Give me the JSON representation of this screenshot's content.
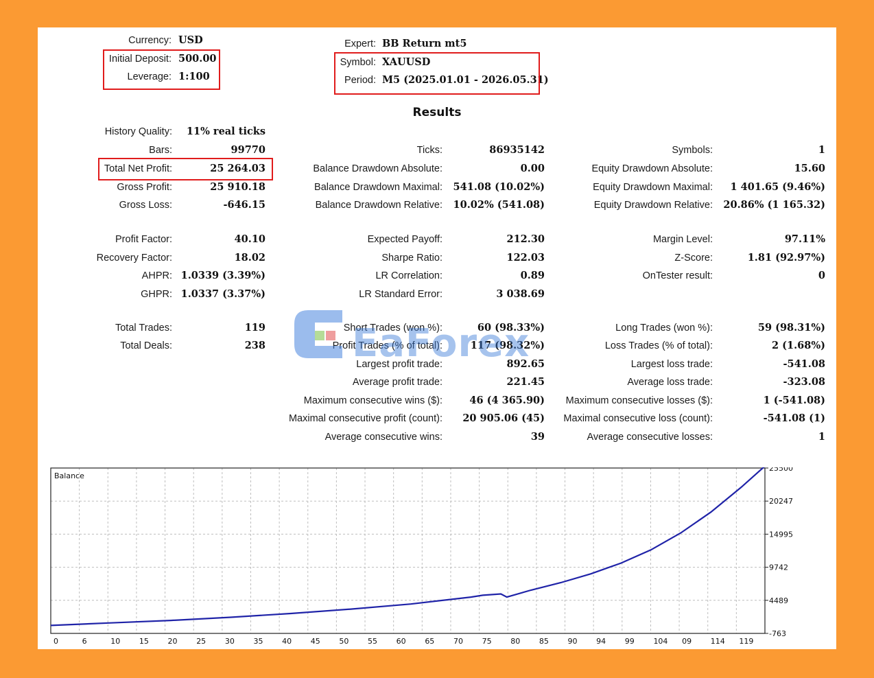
{
  "header": {
    "currency": {
      "label": "Currency:",
      "value": "USD"
    },
    "initial_deposit": {
      "label": "Initial Deposit:",
      "value": "500.00"
    },
    "leverage": {
      "label": "Leverage:",
      "value": "1:100"
    },
    "expert": {
      "label": "Expert:",
      "value": "BB Return mt5"
    },
    "symbol": {
      "label": "Symbol:",
      "value": "XAUUSD"
    },
    "period": {
      "label": "Period:",
      "value": "M5 (2025.01.01 - 2026.05.31)"
    }
  },
  "results_title": "Results",
  "left_col": [
    {
      "label": "History Quality:",
      "value": "11% real ticks"
    },
    {
      "label": "Bars:",
      "value": "99770"
    },
    {
      "label": "Total Net Profit:",
      "value": "25 264.03"
    },
    {
      "label": "Gross Profit:",
      "value": "25 910.18"
    },
    {
      "label": "Gross Loss:",
      "value": "-646.15"
    },
    {
      "label": "Profit Factor:",
      "value": "40.10"
    },
    {
      "label": "Recovery Factor:",
      "value": "18.02"
    },
    {
      "label": "AHPR:",
      "value": "1.0339 (3.39%)"
    },
    {
      "label": "GHPR:",
      "value": "1.0337 (3.37%)"
    },
    {
      "label": "Total Trades:",
      "value": "119"
    },
    {
      "label": "Total Deals:",
      "value": "238"
    }
  ],
  "mid_col": [
    {
      "label": "Ticks:",
      "value": "86935142"
    },
    {
      "label": "Balance Drawdown Absolute:",
      "value": "0.00"
    },
    {
      "label": "Balance Drawdown Maximal:",
      "value": "541.08 (10.02%)"
    },
    {
      "label": "Balance Drawdown Relative:",
      "value": "10.02% (541.08)"
    },
    {
      "label": "Expected Payoff:",
      "value": "212.30"
    },
    {
      "label": "Sharpe Ratio:",
      "value": "122.03"
    },
    {
      "label": "LR Correlation:",
      "value": "0.89"
    },
    {
      "label": "LR Standard Error:",
      "value": "3 038.69"
    },
    {
      "label": "Short Trades (won %):",
      "value": "60 (98.33%)"
    },
    {
      "label": "Profit Trades (% of total):",
      "value": "117 (98.32%)"
    },
    {
      "label": "Largest profit trade:",
      "value": "892.65"
    },
    {
      "label": "Average profit trade:",
      "value": "221.45"
    },
    {
      "label": "Maximum consecutive wins ($):",
      "value": "46 (4 365.90)"
    },
    {
      "label": "Maximal consecutive profit (count):",
      "value": "20 905.06 (45)"
    },
    {
      "label": "Average consecutive wins:",
      "value": "39"
    }
  ],
  "right_col": [
    {
      "label": "Symbols:",
      "value": "1"
    },
    {
      "label": "Equity Drawdown Absolute:",
      "value": "15.60"
    },
    {
      "label": "Equity Drawdown Maximal:",
      "value": "1 401.65 (9.46%)"
    },
    {
      "label": "Equity Drawdown Relative:",
      "value": "20.86% (1 165.32)"
    },
    {
      "label": "Margin Level:",
      "value": "97.11%"
    },
    {
      "label": "Z-Score:",
      "value": "1.81 (92.97%)"
    },
    {
      "label": "OnTester result:",
      "value": "0"
    },
    {
      "label": "Long Trades (won %):",
      "value": "59 (98.31%)"
    },
    {
      "label": "Loss Trades (% of total):",
      "value": "2 (1.68%)"
    },
    {
      "label": "Largest loss trade:",
      "value": "-541.08"
    },
    {
      "label": "Average loss trade:",
      "value": "-323.08"
    },
    {
      "label": "Maximum consecutive losses ($):",
      "value": "1 (-541.08)"
    },
    {
      "label": "Maximal consecutive loss (count):",
      "value": "-541.08 (1)"
    },
    {
      "label": "Average consecutive losses:",
      "value": "1"
    }
  ],
  "watermark": "EaForex",
  "colors": {
    "background": "#fb9a33",
    "highlight_box": "#e01b1b",
    "balance_line": "#1f23a8"
  },
  "chart_data": {
    "type": "line",
    "title": "Balance",
    "xlabel": "",
    "ylabel": "",
    "x_tick_labels": [
      "0",
      "6",
      "10",
      "15",
      "20",
      "25",
      "30",
      "35",
      "40",
      "45",
      "50",
      "55",
      "60",
      "65",
      "70",
      "75",
      "80",
      "85",
      "90",
      "94",
      "99",
      "104",
      "09",
      "114",
      "119"
    ],
    "y_tick_labels": [
      "25500",
      "20247",
      "14995",
      "9742",
      "4489",
      "-763"
    ],
    "ylim": [
      -763,
      25500
    ],
    "xlim": [
      0,
      119
    ],
    "grid": true,
    "series": [
      {
        "x": [
          0,
          10,
          20,
          30,
          40,
          50,
          60,
          70,
          72,
          75,
          76,
          80,
          85,
          90,
          95,
          100,
          105,
          110,
          115,
          119
        ],
        "values": [
          500,
          900,
          1300,
          1800,
          2400,
          3100,
          3900,
          5000,
          5300,
          5500,
          5000,
          6100,
          7300,
          8700,
          10400,
          12500,
          15200,
          18500,
          22400,
          25800
        ]
      }
    ]
  }
}
